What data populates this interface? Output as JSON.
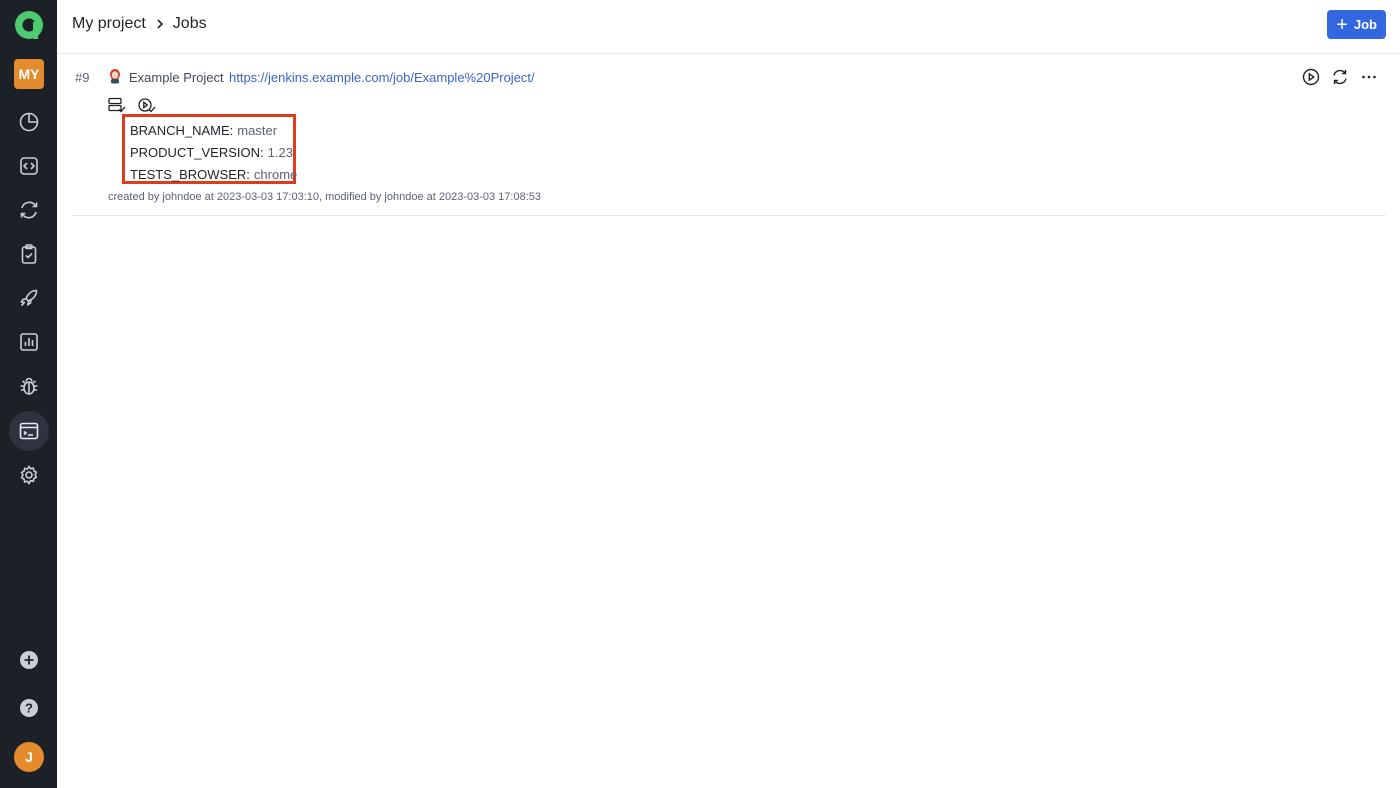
{
  "header": {
    "project": "My project",
    "section": "Jobs",
    "add_label": "Job"
  },
  "sidebar": {
    "project_badge": "MY",
    "avatar_initial": "J",
    "icons": [
      "logo-icon",
      "dashboard-icon",
      "code-icon",
      "launches-icon",
      "testcases-icon",
      "rocket-icon",
      "analytics-icon",
      "bug-icon",
      "jobs-icon",
      "settings-icon",
      "add-icon",
      "help-icon"
    ],
    "active": "jobs-icon"
  },
  "job": {
    "number": "#9",
    "name": "Example Project",
    "url": "https://jenkins.example.com/job/Example%20Project/",
    "params": [
      {
        "key": "BRANCH_NAME:",
        "value": "master"
      },
      {
        "key": "PRODUCT_VERSION:",
        "value": "1.23"
      },
      {
        "key": "TESTS_BROWSER:",
        "value": "chrome"
      }
    ],
    "meta": "created by johndoe at 2023-03-03 17:03:10, modified by johndoe at 2023-03-03 17:08:53"
  },
  "colors": {
    "sidebar_bg": "#1c2128",
    "accent": "#3367e0",
    "badge": "#e38b2d",
    "highlight": "#e03a20",
    "logo": "#4ecb71"
  }
}
